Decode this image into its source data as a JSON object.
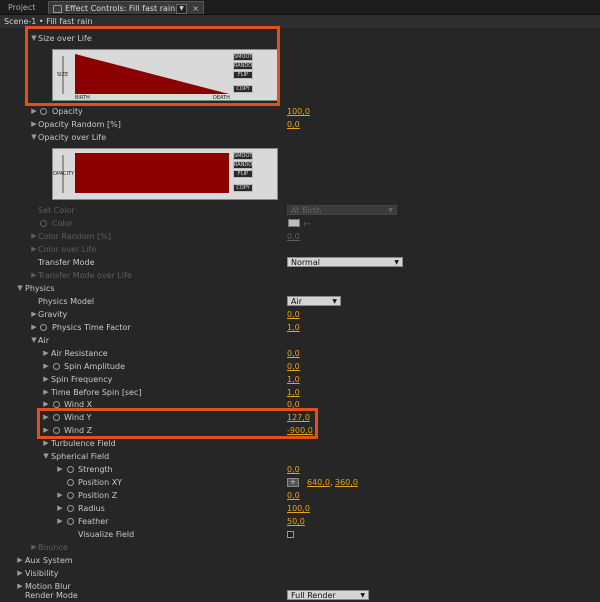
{
  "tabs": {
    "project": "Project",
    "effect_controls": "Effect Controls: Fill fast rain"
  },
  "breadcrumb": "Scene-1 • Fill fast rain",
  "graph_labels": {
    "size": "SIZE",
    "opacity": "OPACITY",
    "birth": "BIRTH",
    "death": "DEATH"
  },
  "graph_buttons": [
    "SMOOTH",
    "RANDOM",
    "FLIP",
    "COPY"
  ],
  "colors": {
    "accent_value": "#e8a317",
    "highlight": "#e2501c",
    "graph_fill": "#8b0000"
  },
  "chart_data": [
    {
      "type": "area",
      "title": "",
      "xlabel": "BIRTH → DEATH",
      "ylabel": "SIZE",
      "x": [
        0,
        1
      ],
      "values": [
        1,
        0
      ]
    },
    {
      "type": "area",
      "title": "",
      "xlabel": "BIRTH → DEATH",
      "ylabel": "OPACITY",
      "x": [
        0,
        1
      ],
      "values": [
        1,
        1
      ]
    }
  ],
  "rows": {
    "size_over_life": "Size over Life",
    "opacity": {
      "label": "Opacity",
      "value": "100,0"
    },
    "opacity_random": {
      "label": "Opacity Random [%]",
      "value": "0,0"
    },
    "opacity_over_life": "Opacity over Life",
    "set_color": {
      "label": "Set Color",
      "value": "At Birth"
    },
    "color": {
      "label": "Color"
    },
    "color_random": {
      "label": "Color Random [%]",
      "value": "0,0"
    },
    "color_over_life": "Color over Life",
    "transfer_mode": {
      "label": "Transfer Mode",
      "value": "Normal"
    },
    "transfer_mode_over_life": "Transfer Mode over Life",
    "physics": "Physics",
    "physics_model": {
      "label": "Physics Model",
      "value": "Air"
    },
    "gravity": {
      "label": "Gravity",
      "value": "0,0"
    },
    "physics_time_factor": {
      "label": "Physics Time Factor",
      "value": "1,0"
    },
    "air": "Air",
    "air_resistance": {
      "label": "Air Resistance",
      "value": "0,0"
    },
    "spin_amplitude": {
      "label": "Spin Amplitude",
      "value": "0,0"
    },
    "spin_frequency": {
      "label": "Spin Frequency",
      "value": "1,0"
    },
    "time_before_spin": {
      "label": "Time Before Spin [sec]",
      "value": "1,0"
    },
    "wind_x": {
      "label": "Wind X",
      "value": "0,0"
    },
    "wind_y": {
      "label": "Wind Y",
      "value": "127,0"
    },
    "wind_z": {
      "label": "Wind Z",
      "value": "-900,0"
    },
    "turbulence_field": "Turbulence Field",
    "spherical_field": "Spherical Field",
    "strength": {
      "label": "Strength",
      "value": "0,0"
    },
    "position_xy": {
      "label": "Position XY",
      "value_x": "640,0",
      "value_y": "360,0"
    },
    "position_z": {
      "label": "Position Z",
      "value": "0,0"
    },
    "radius": {
      "label": "Radius",
      "value": "100,0"
    },
    "feather": {
      "label": "Feather",
      "value": "50,0"
    },
    "visualize_field": {
      "label": "Visualize Field"
    },
    "bounce": "Bounce",
    "aux_system": "Aux System",
    "visibility": "Visibility",
    "motion_blur": "Motion Blur",
    "render_mode": {
      "label": "Render Mode",
      "value": "Full Render"
    }
  }
}
